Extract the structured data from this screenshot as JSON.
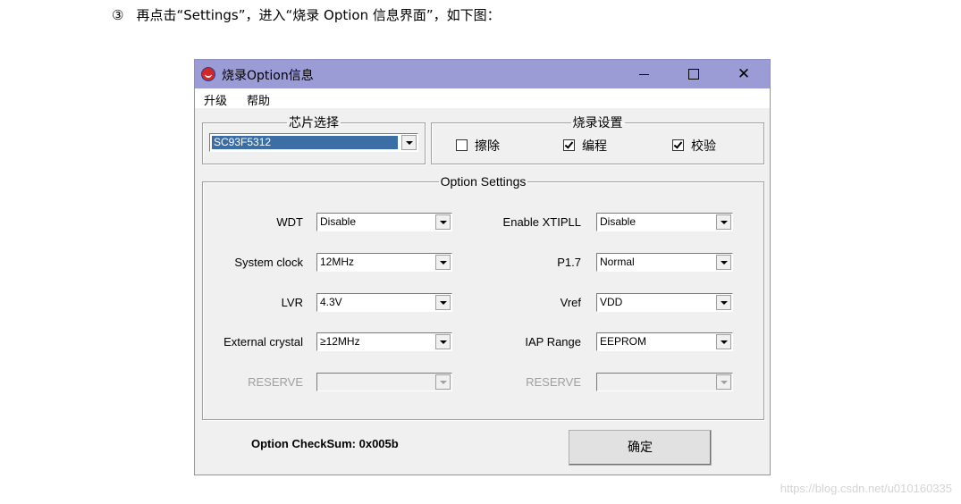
{
  "caption": {
    "step_num": "③",
    "text": "再点击“Settings”，进入“烧录 Option 信息界面”，如下图："
  },
  "watermark": "https://blog.csdn.net/u010160335",
  "window": {
    "title": "烧录Option信息",
    "minimize_label": "—",
    "close_label": "✕"
  },
  "menu": {
    "items": [
      "升级",
      "帮助"
    ]
  },
  "chip_select": {
    "legend": "芯片选择",
    "value": "SC93F5312"
  },
  "burn_settings": {
    "legend": "烧录设置",
    "erase": {
      "label": "擦除",
      "checked": false
    },
    "program": {
      "label": "编程",
      "checked": true
    },
    "verify": {
      "label": "校验",
      "checked": true
    }
  },
  "option_settings": {
    "legend": "Option Settings",
    "left": [
      {
        "label": "WDT",
        "value": "Disable",
        "enabled": true
      },
      {
        "label": "System clock",
        "value": "12MHz",
        "enabled": true
      },
      {
        "label": "LVR",
        "value": "4.3V",
        "enabled": true
      },
      {
        "label": "External crystal",
        "value": "≥12MHz",
        "enabled": true
      },
      {
        "label": "RESERVE",
        "value": "",
        "enabled": false
      }
    ],
    "right": [
      {
        "label": "Enable XTIPLL",
        "value": "Disable",
        "enabled": true
      },
      {
        "label": "P1.7",
        "value": "Normal",
        "enabled": true
      },
      {
        "label": "Vref",
        "value": "VDD",
        "enabled": true
      },
      {
        "label": "IAP Range",
        "value": "EEPROM",
        "enabled": true
      },
      {
        "label": "RESERVE",
        "value": "",
        "enabled": false
      }
    ]
  },
  "checksum": {
    "text": "Option CheckSum:  0x005b"
  },
  "ok_button": "确定",
  "colors": {
    "titlebar": "#9b9bd6",
    "selection": "#3a6ea5",
    "window_bg": "#f0f0f0"
  }
}
